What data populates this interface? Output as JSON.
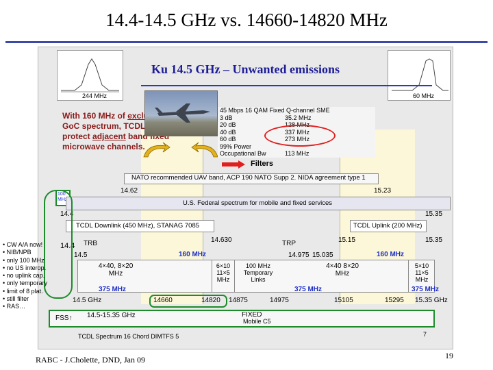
{
  "slide": {
    "title": "14.4-14.5 GHz vs. 14660-14820 MHz",
    "footer": "RABC - J.Cholette, DND, Jan 09",
    "page_number": "19",
    "bullets": [
      "CW A/A now!",
      "NIB/NPB",
      "only 100 MHz",
      "no US interop.",
      "no uplink cap.",
      "only temporary",
      "limit of 8 plat.",
      "still filter",
      "RAS…"
    ]
  },
  "graphic": {
    "title": "Ku 14.5 GHz – Unwanted emissions",
    "left_thumb_label": "244 MHz",
    "right_thumb_label": "60 MHz",
    "intro_parts": [
      "With 160 MHz of ",
      "exclusive",
      " GoC spectrum, TCDL ",
      "must",
      " protect ",
      "adjacent",
      " band fixed microwave channels."
    ],
    "table_header": "45 Mbps 16 QAM Fixed Q-channel SME",
    "table_rows": [
      [
        "3 dB",
        "35.2 MHz"
      ],
      [
        "20 dB",
        "128 MHz"
      ],
      [
        "40 dB",
        "337 MHz"
      ],
      [
        "60 dB",
        "273 MHz"
      ],
      [
        "99% Power",
        ""
      ],
      [
        "Occupational Bw",
        "113 MHz"
      ]
    ],
    "filters_label": "Filters",
    "nato_label": "NATO recommended UAV band, ACP 190 NATO Supp 2. NIDA agreement type 1",
    "freq_1462": "14.62",
    "freq_1523": "15.23",
    "note_100mhz": "100 MHz",
    "us_federal": "U.S. Federal spectrum for mobile and fixed services",
    "freq_144": "14.4",
    "freq_1535": "15.35",
    "tcdl_downlink": "TCDL Downlink (450 MHz), STANAG 7085",
    "tcdl_uplink": "TCDL Uplink (200 MHz)",
    "freq_144b": "14.4",
    "freq_1463": "14.630",
    "freq_1515": "15.15",
    "freq_1535b": "15.35",
    "trb": "TRB",
    "trp": "TRP",
    "freq_145": "14.5",
    "freq_14975": "14.975",
    "freq_15035": "15.035",
    "mhz160_a": "160 MHz",
    "mhz160_b": "160 MHz",
    "cell_4x40": "4×40, 8×20 MHz",
    "cell_6x10": "6×10 11×5 MHz",
    "cell_100mhz": "100 MHz Temporary Links",
    "cell_4x40b": "4×40 8×20 MHz",
    "cell_5x10": "5×10 11×5 MHz",
    "mhz375_a": "375 MHz",
    "mhz375_b": "375 MHz",
    "mhz375_c": "375 MHz",
    "axis_labels": [
      "14.5 GHz",
      "14660",
      "14820",
      "14875",
      "14975",
      "15105",
      "15295",
      "15.35 GHz"
    ],
    "fss_label": "FSS↑",
    "fss_range": "14.5-15.35 GHz",
    "fixed_label": "FIXED",
    "mobile_label": "Mobile C5",
    "bottom_caption": "TCDL Spectrum  16 Chord  DIMTFS 5",
    "small_num": "7"
  }
}
